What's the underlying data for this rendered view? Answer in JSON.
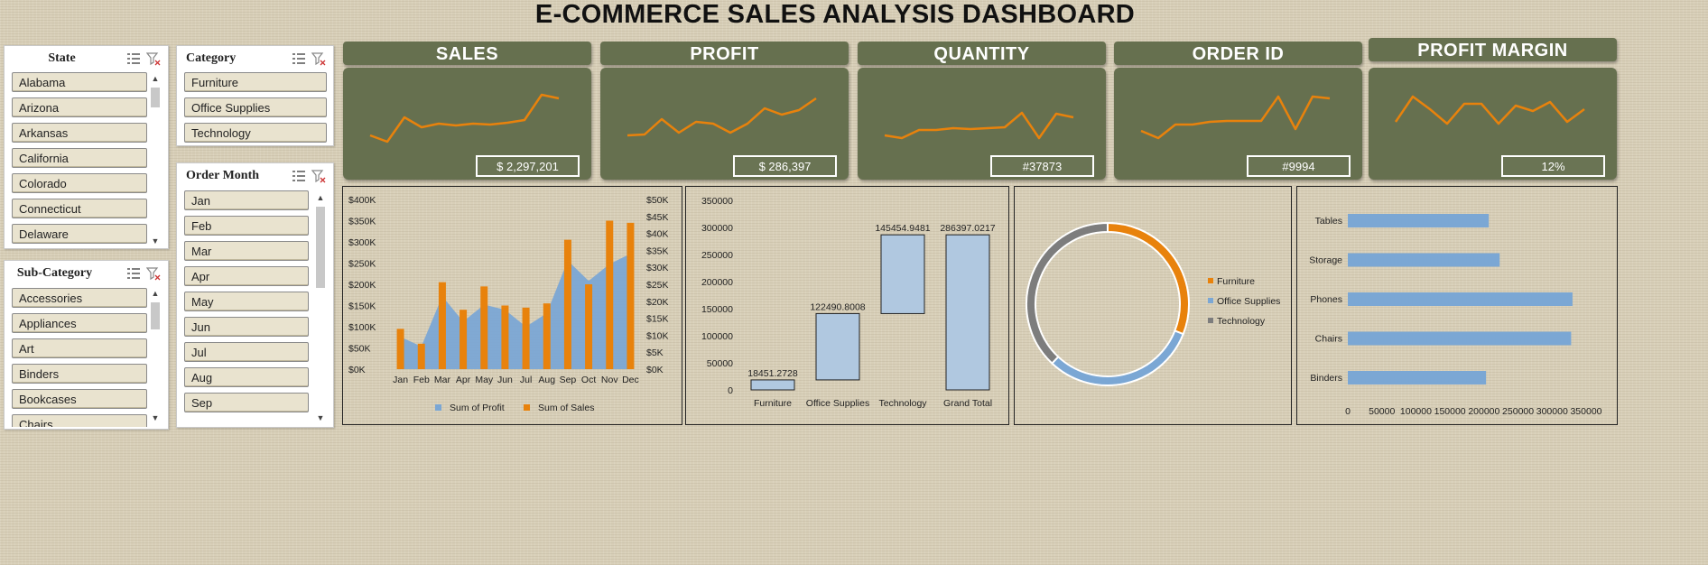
{
  "title": "E-COMMERCE SALES ANALYSIS DASHBOARD",
  "slicers": {
    "state": {
      "label": "State",
      "items": [
        "Alabama",
        "Arizona",
        "Arkansas",
        "California",
        "Colorado",
        "Connecticut",
        "Delaware"
      ]
    },
    "category": {
      "label": "Category",
      "items": [
        "Furniture",
        "Office Supplies",
        "Technology"
      ]
    },
    "subcategory": {
      "label": "Sub-Category",
      "items": [
        "Accessories",
        "Appliances",
        "Art",
        "Binders",
        "Bookcases",
        "Chairs"
      ]
    },
    "order_month": {
      "label": "Order Month",
      "items": [
        "Jan",
        "Feb",
        "Mar",
        "Apr",
        "May",
        "Jun",
        "Jul",
        "Aug",
        "Sep"
      ]
    }
  },
  "kpis": [
    {
      "label": "SALES",
      "value": "$  2,297,201"
    },
    {
      "label": "PROFIT",
      "value": "$  286,397"
    },
    {
      "label": "QUANTITY",
      "value": "#37873"
    },
    {
      "label": "ORDER ID",
      "value": "#9994"
    },
    {
      "label": "PROFIT MARGIN",
      "value": "12%"
    }
  ],
  "colors": {
    "accent_orange": "#e8820c",
    "accent_blue": "#7ba7d4",
    "kpi_green": "#66704f"
  },
  "chart_data": [
    {
      "type": "area",
      "categories": [
        "Jan",
        "Feb",
        "Mar",
        "Apr",
        "May",
        "Jun",
        "Jul",
        "Aug",
        "Sep",
        "Oct",
        "Nov",
        "Dec"
      ],
      "series": [
        {
          "name": "Sum of Profit",
          "type": "area",
          "axis": "right",
          "values": [
            9500,
            6700,
            21500,
            14000,
            19000,
            17500,
            12500,
            16500,
            32000,
            26000,
            31000,
            34000
          ]
        },
        {
          "name": "Sum of Sales",
          "type": "bar",
          "axis": "left",
          "values": [
            95000,
            60000,
            205000,
            140000,
            195000,
            150000,
            145000,
            155000,
            305000,
            200000,
            350000,
            345000
          ]
        }
      ],
      "y_left_ticks": [
        "$0K",
        "$50K",
        "$100K",
        "$150K",
        "$200K",
        "$250K",
        "$300K",
        "$350K",
        "$400K"
      ],
      "y_right_ticks": [
        "$0K",
        "$5K",
        "$10K",
        "$15K",
        "$20K",
        "$25K",
        "$30K",
        "$35K",
        "$40K",
        "$45K",
        "$50K"
      ],
      "ylim_left": [
        0,
        400000
      ],
      "ylim_right": [
        0,
        50000
      ],
      "legend": "bottom"
    },
    {
      "type": "bar",
      "subtype": "waterfall",
      "categories": [
        "Furniture",
        "Office Supplies",
        "Technology",
        "Grand Total"
      ],
      "values": [
        18451.2728,
        122490.8008,
        145454.9481,
        286397.0217
      ],
      "labels": [
        "18451.2728",
        "122490.8008",
        "145454.9481",
        "286397.0217"
      ],
      "y_ticks": [
        "0",
        "50000",
        "100000",
        "150000",
        "200000",
        "250000",
        "300000",
        "350000"
      ],
      "ylim": [
        0,
        350000
      ]
    },
    {
      "type": "pie",
      "subtype": "doughnut",
      "categories": [
        "Furniture",
        "Office Supplies",
        "Technology"
      ],
      "values": [
        31,
        31,
        38
      ],
      "colors": [
        "#e8820c",
        "#7ba7d4",
        "#7d7d7d"
      ],
      "legend": "right"
    },
    {
      "type": "bar",
      "orientation": "horizontal",
      "categories": [
        "Tables",
        "Storage",
        "Phones",
        "Chairs",
        "Binders"
      ],
      "values": [
        207000,
        223000,
        330000,
        328000,
        203000
      ],
      "x_ticks": [
        "0",
        "50000",
        "100000",
        "150000",
        "200000",
        "250000",
        "300000",
        "350000"
      ],
      "xlim": [
        0,
        350000
      ]
    }
  ]
}
